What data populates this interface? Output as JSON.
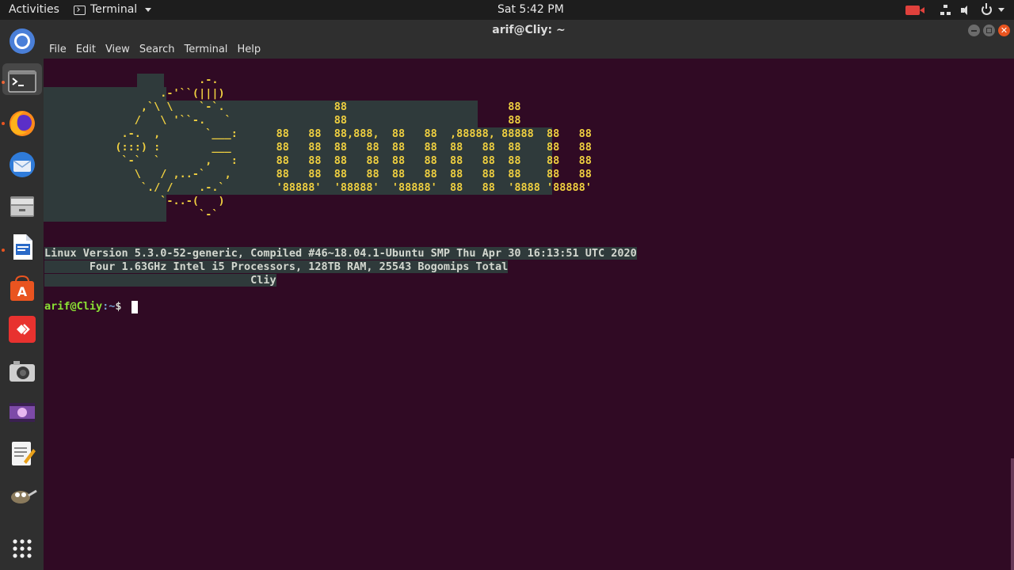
{
  "topbar": {
    "activities": "Activities",
    "app_name": "Terminal",
    "clock": "Sat  5:42 PM"
  },
  "window": {
    "title": "arif@Cliy: ~"
  },
  "menu": [
    "File",
    "Edit",
    "View",
    "Search",
    "Terminal",
    "Help"
  ],
  "dock": [
    {
      "name": "chromium-icon"
    },
    {
      "name": "terminal-icon",
      "active": true
    },
    {
      "name": "firefox-icon"
    },
    {
      "name": "thunderbird-icon"
    },
    {
      "name": "files-icon"
    },
    {
      "name": "libreoffice-writer-icon"
    },
    {
      "name": "software-center-icon"
    },
    {
      "name": "anydesk-icon"
    },
    {
      "name": "camera-icon"
    },
    {
      "name": "video-editor-icon"
    },
    {
      "name": "text-editor-icon"
    },
    {
      "name": "gimp-icon"
    },
    {
      "name": "show-apps-icon"
    }
  ],
  "terminal": {
    "banner": [
      "                        .-.",
      "                  .-'``(|||)",
      "               ,`\\ \\    `-`.                 88                         88",
      "              /   \\ '``-.   `                88                         88",
      "            .-.  ,       `___:      88   88  88,888,  88   88  ,88888, 88888  88   88",
      "           (:::) :        ___       88   88  88   88  88   88  88   88  88    88   88",
      "            `-`  `       ,   :      88   88  88   88  88   88  88   88  88    88   88",
      "              \\   / ,..-`   ,       88   88  88   88  88   88  88   88  88    88   88",
      "               `./ /    .-.`        '88888'  '88888'  '88888'  88   88  '8888 '88888'",
      "                  `-..-(   )",
      "                        `-`"
    ],
    "sysinfo": [
      "Linux Version 5.3.0-52-generic, Compiled #46~18.04.1-Ubuntu SMP Thu Apr 30 16:13:51 UTC 2020",
      "       Four 1.63GHz Intel i5 Processors, 128TB RAM, 25543 Bogomips Total",
      "                                Cliy"
    ],
    "prompt_user": "arif@Cliy",
    "prompt_path": ":~",
    "prompt_symbol": "$ "
  }
}
